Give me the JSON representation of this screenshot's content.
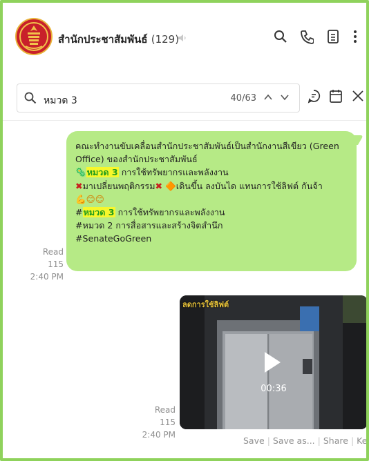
{
  "header": {
    "group_name": "สำนักประชาสัมพันธ์",
    "member_count": "(129)",
    "icons": [
      "speaker-muted-icon",
      "search-icon",
      "phone-icon",
      "notes-icon",
      "more-icon"
    ]
  },
  "search": {
    "query": "หมวด 3",
    "position": "40/63",
    "icons": [
      "search-icon",
      "chevron-up-icon",
      "chevron-down-icon",
      "chat-bubble-icon",
      "calendar-icon",
      "close-icon"
    ]
  },
  "message1": {
    "line1": "คณะทำงานขับเคลื่อนสำนักประชาสัมพันธ์เป็นสำนักงานสีเขียว (Green",
    "line2": "Office) ของสำนักประชาสัมพันธ์",
    "line3_prefix": "🦠",
    "line3_highlight": "หมวด 3",
    "line3_rest": " การใช้ทรัพยากรและพลังงาน",
    "line4_x1": "✖",
    "line4_a": "มาเปลี่ยนพฤติกรรม",
    "line4_x2": "✖",
    "line4_sign": "🔶",
    "line4_b": "เดินขึ้น ลงบันได แทนการใช้ลิฟต์ กันจ้า",
    "line5_emoji": "💪😊😊",
    "line6_hash": "#",
    "line6_highlight": "หมวด 3",
    "line6_rest": " การใช้ทรัพยากรและพลังงาน",
    "line7": "#หมวด 2 การสื่อสารและสร้างจิตสำนึก",
    "line8": "#SenateGoGreen",
    "read": "Read 115",
    "time": "2:40 PM"
  },
  "message2": {
    "video_overlay_text": "ลดการใช้ลิฟต์",
    "duration": "00:36",
    "read": "Read 115",
    "time": "2:40 PM",
    "actions": [
      "Save",
      "Save as...",
      "Share",
      "Keep"
    ]
  },
  "colors": {
    "border": "#8fd25c",
    "bubble": "#b6ea86",
    "highlight": "#f7f72c",
    "highlight_text": "#1e9b1e"
  }
}
